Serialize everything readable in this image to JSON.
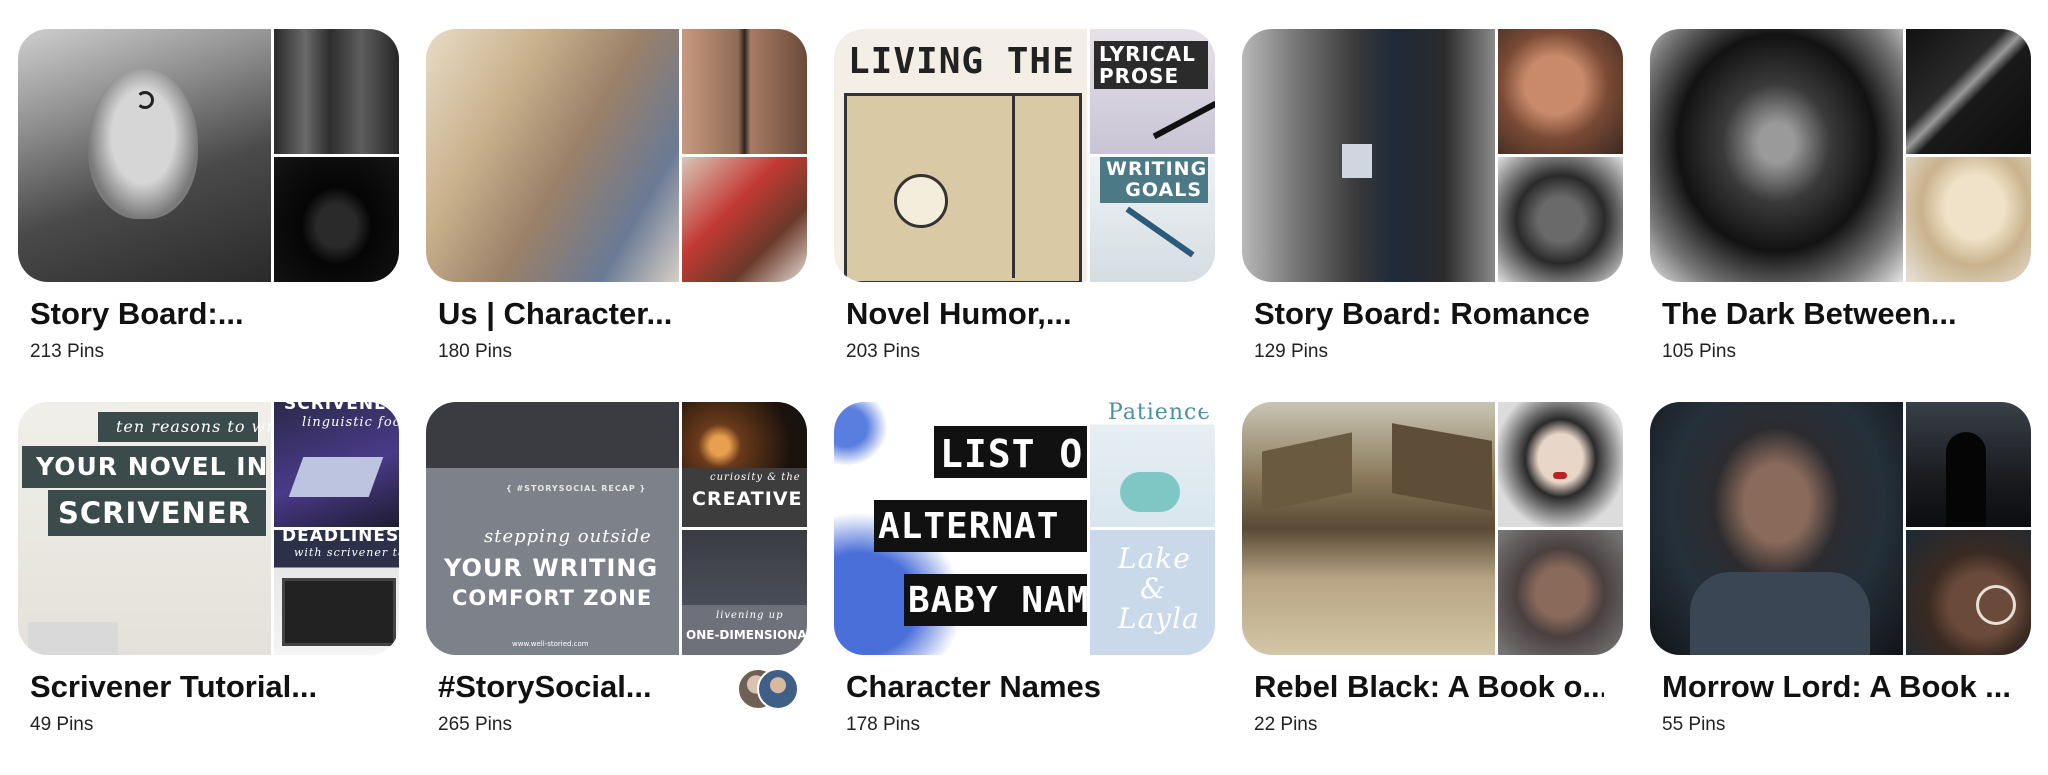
{
  "boards": [
    {
      "title": "Story Board:...",
      "pins": "213 Pins",
      "cover_colors": [
        "#8a8a8a",
        "#3e3e3e",
        "#121212"
      ]
    },
    {
      "title": "Us | Character...",
      "pins": "180 Pins",
      "cover_colors": [
        "#c9b49a",
        "#6d5848",
        "#b9473e"
      ]
    },
    {
      "title": "Novel Humor,...",
      "pins": "203 Pins",
      "cover_colors": [
        "#d7c9a8",
        "#2f2a2a",
        "#dfe8ef"
      ],
      "cover_text": {
        "main": "LIVING THE D",
        "top": "LYRICAL PROSE",
        "bottom": "WRITING GOALS"
      }
    },
    {
      "title": "Story Board: Romance",
      "pins": "129 Pins",
      "cover_colors": [
        "#6f6f6f",
        "#9a5b43",
        "#4a4a4a"
      ]
    },
    {
      "title": "The Dark Between...",
      "pins": "105 Pins",
      "cover_colors": [
        "#4d4d4d",
        "#1f1f1f",
        "#d8c7a8"
      ]
    },
    {
      "title": "Scrivener Tutorial...",
      "pins": "49 Pins",
      "cover_colors": [
        "#e9e6e0",
        "#3b3a5c",
        "#2a2a2a"
      ],
      "cover_text": {
        "main_small": "ten reasons to write",
        "main_line1": "YOUR NOVEL IN",
        "main_line2": "SCRIVENER",
        "top_line1": "SCRIVENER",
        "top_line2": "linguistic focus",
        "bottom_line1": "DEADLINES",
        "bottom_line2": "with scrivener targets"
      }
    },
    {
      "title": "#StorySocial...",
      "pins": "265 Pins",
      "cover_colors": [
        "#7d818a",
        "#5a3b26",
        "#3d3d3d"
      ],
      "cover_text": {
        "main_tag": "{ #STORYSOCIAL RECAP }",
        "main_line1": "stepping outside",
        "main_line2": "YOUR WRITING",
        "main_line3": "COMFORT ZONE",
        "main_url": "www.well-storied.com",
        "top_small": "curiosity & the",
        "top_big": "CREATIVE",
        "bottom_small": "livening up",
        "bottom_big": "ONE-DIMENSIONAL"
      }
    },
    {
      "title": "Character Names",
      "pins": "178 Pins",
      "cover_colors": [
        "#ffffff",
        "#e2edf4",
        "#c9d9ea"
      ],
      "cover_text": {
        "main_line1": "LIST O",
        "main_line2": "ALTERNAT",
        "main_line3": "BABY NAM",
        "top": "Patience",
        "bottom": "Lake & Layla"
      }
    },
    {
      "title": "Rebel Black: A Book o...",
      "pins": "22 Pins",
      "cover_colors": [
        "#9c8a6c",
        "#d9d4d0",
        "#6a5a50"
      ]
    },
    {
      "title": "Morrow Lord: A Book ...",
      "pins": "55 Pins",
      "cover_colors": [
        "#2c3a46",
        "#1b1e22",
        "#4a3a33"
      ]
    }
  ]
}
